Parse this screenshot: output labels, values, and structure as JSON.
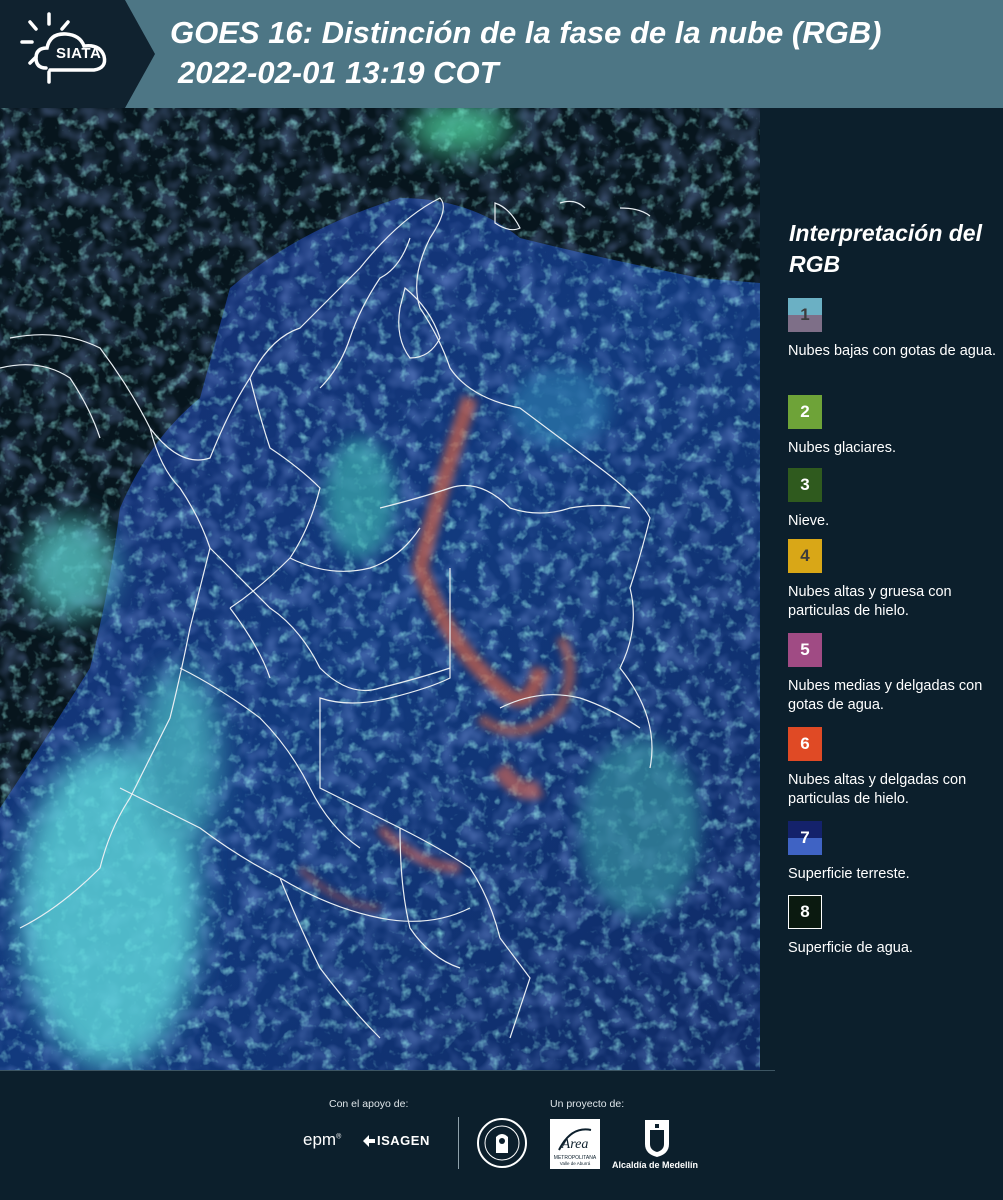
{
  "header": {
    "logo_text": "SIATA",
    "title": "GOES 16: Distinción de la fase de la nube (RGB)",
    "subtitle": "2022-02-01 13:19 COT"
  },
  "legend": {
    "title": "Interpretación del RGB",
    "items": [
      {
        "number": "1",
        "label": "Nubes bajas con gotas de agua.",
        "color_top": "#6bb0c4",
        "color_bottom": "#7e6f88",
        "number_color": "#3b3b3b"
      },
      {
        "number": "2",
        "label": "Nubes glaciares.",
        "color_top": "#6ea338",
        "color_bottom": "#6ea338",
        "number_color": "#ffffff"
      },
      {
        "number": "3",
        "label": "Nieve.",
        "color_top": "#2f5a1e",
        "color_bottom": "#2f5a1e",
        "number_color": "#ffffff"
      },
      {
        "number": "4",
        "label": "Nubes altas y gruesa con particulas de hielo.",
        "color_top": "#d9a717",
        "color_bottom": "#d9a717",
        "number_color": "#3b3b3b"
      },
      {
        "number": "5",
        "label": "Nubes medias y delgadas con gotas de agua.",
        "color_top": "#a04b84",
        "color_bottom": "#a04b84",
        "number_color": "#ffffff"
      },
      {
        "number": "6",
        "label": "Nubes altas y delgadas con particulas de hielo.",
        "color_top": "#e04a25",
        "color_bottom": "#e04a25",
        "number_color": "#ffffff"
      },
      {
        "number": "7",
        "label": "Superficie terreste.",
        "color_top": "#14226b",
        "color_bottom": "#3f63c4",
        "number_color": "#ffffff"
      },
      {
        "number": "8",
        "label": "Superficie de agua.",
        "color_top": "#0b1a10",
        "color_bottom": "#0b1a10",
        "number_color": "#ffffff"
      }
    ]
  },
  "footer": {
    "support_label": "Con el apoyo de:",
    "project_label": "Un proyecto de:",
    "sponsors": [
      "epm",
      "ISAGEN"
    ],
    "partners": [
      "Área Metropolitana Valle de Aburrá",
      "Alcaldía de Medellín"
    ],
    "alcaldia_label": "Alcaldía de Medellín",
    "area_label_main": "Área",
    "area_label_sub1": "METROPOLITANA",
    "area_label_sub2": "Valle de Aburrá"
  }
}
